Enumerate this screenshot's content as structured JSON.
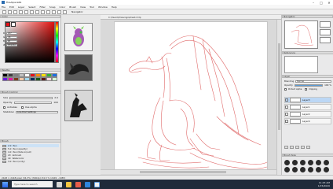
{
  "window": {
    "title": "FireAlpaca64",
    "minimize": "–",
    "maximize": "□",
    "close": "✕"
  },
  "menu": [
    "File",
    "Edit",
    "Layer",
    "Select",
    "Filter",
    "Snap",
    "Color",
    "Brush",
    "View",
    "Tool",
    "Window",
    "Help"
  ],
  "toolbar_icons": [
    "pen-icon",
    "eraser-icon",
    "bucket-icon",
    "gradient-icon",
    "select-icon",
    "lasso-icon",
    "wand-icon",
    "move-icon",
    "hand-icon",
    "eyedropper-icon",
    "text-icon",
    "zoom-icon"
  ],
  "navigator": {
    "label": "Navigator"
  },
  "color": {
    "label": "Color",
    "main": "#e3121a",
    "sub": "#ffffff",
    "fields": [
      {
        "label": "R",
        "value": "227"
      },
      {
        "label": "G",
        "value": "18"
      },
      {
        "label": "B",
        "value": "26"
      },
      {
        "label": "#",
        "value": "E3121A"
      }
    ]
  },
  "palette": {
    "label": "Palette",
    "colors": [
      "#000000",
      "#404040",
      "#808080",
      "#c0c0c0",
      "#ffffff",
      "#e3121a",
      "#ff8c00",
      "#ffe000",
      "#33b033",
      "#1a6fe3",
      "#6a1ae3",
      "#e31a9c",
      "#7a3b1a",
      "#f2c7a5",
      "#a0d8ef",
      "#0a2a5a",
      "#1a5a1a",
      "#5a1a1a",
      "#ffd6e0",
      "#d6ffd6"
    ]
  },
  "brush_control": {
    "label": "Brush Control",
    "size_label": "Size",
    "size": "2.0",
    "opacity_label": "Opacity",
    "opacity": "100",
    "antialias": "Antialias",
    "blend": "Use alpha",
    "stabilizer": "Stabilizer",
    "stabilizer_value": "Low-direct settings"
  },
  "brush": {
    "label": "Brush",
    "items": [
      {
        "size": "2.0",
        "name": "Pen"
      },
      {
        "size": "5.0",
        "name": "Pen (opacity)"
      },
      {
        "size": "4.0",
        "name": "Pen (fade in/out)"
      },
      {
        "size": "20",
        "name": "Airbrush"
      },
      {
        "size": "40",
        "name": "Watercolor"
      },
      {
        "size": "3.0",
        "name": "Pen (unity)"
      }
    ]
  },
  "canvas": {
    "tab": "sheet.mdp - Drawing",
    "path": "C:\\Users\\Drawings\\sheet.mdp"
  },
  "right": {
    "navigator_label": "Navigator",
    "reference_label": "Reference",
    "layer_label": "Layer",
    "blending_label": "Blending",
    "blending_value": "Normal",
    "opacity_label": "Opacity",
    "opacity_value": "100 %",
    "protect_label": "Protect Alpha",
    "clipping_label": "Clipping",
    "layers": [
      "Layer3",
      "Layer1",
      "Layer2",
      "Layer0"
    ],
    "brushsize_label": "Brush Size"
  },
  "status": {
    "text": "2448 × 2448 pixel  (34.3%)  (300dpi)  34.3 %  (2445, -1085)"
  },
  "taskbar": {
    "search_placeholder": "Type here to search",
    "time": "11:43 AM",
    "date": "1/15/2020"
  }
}
